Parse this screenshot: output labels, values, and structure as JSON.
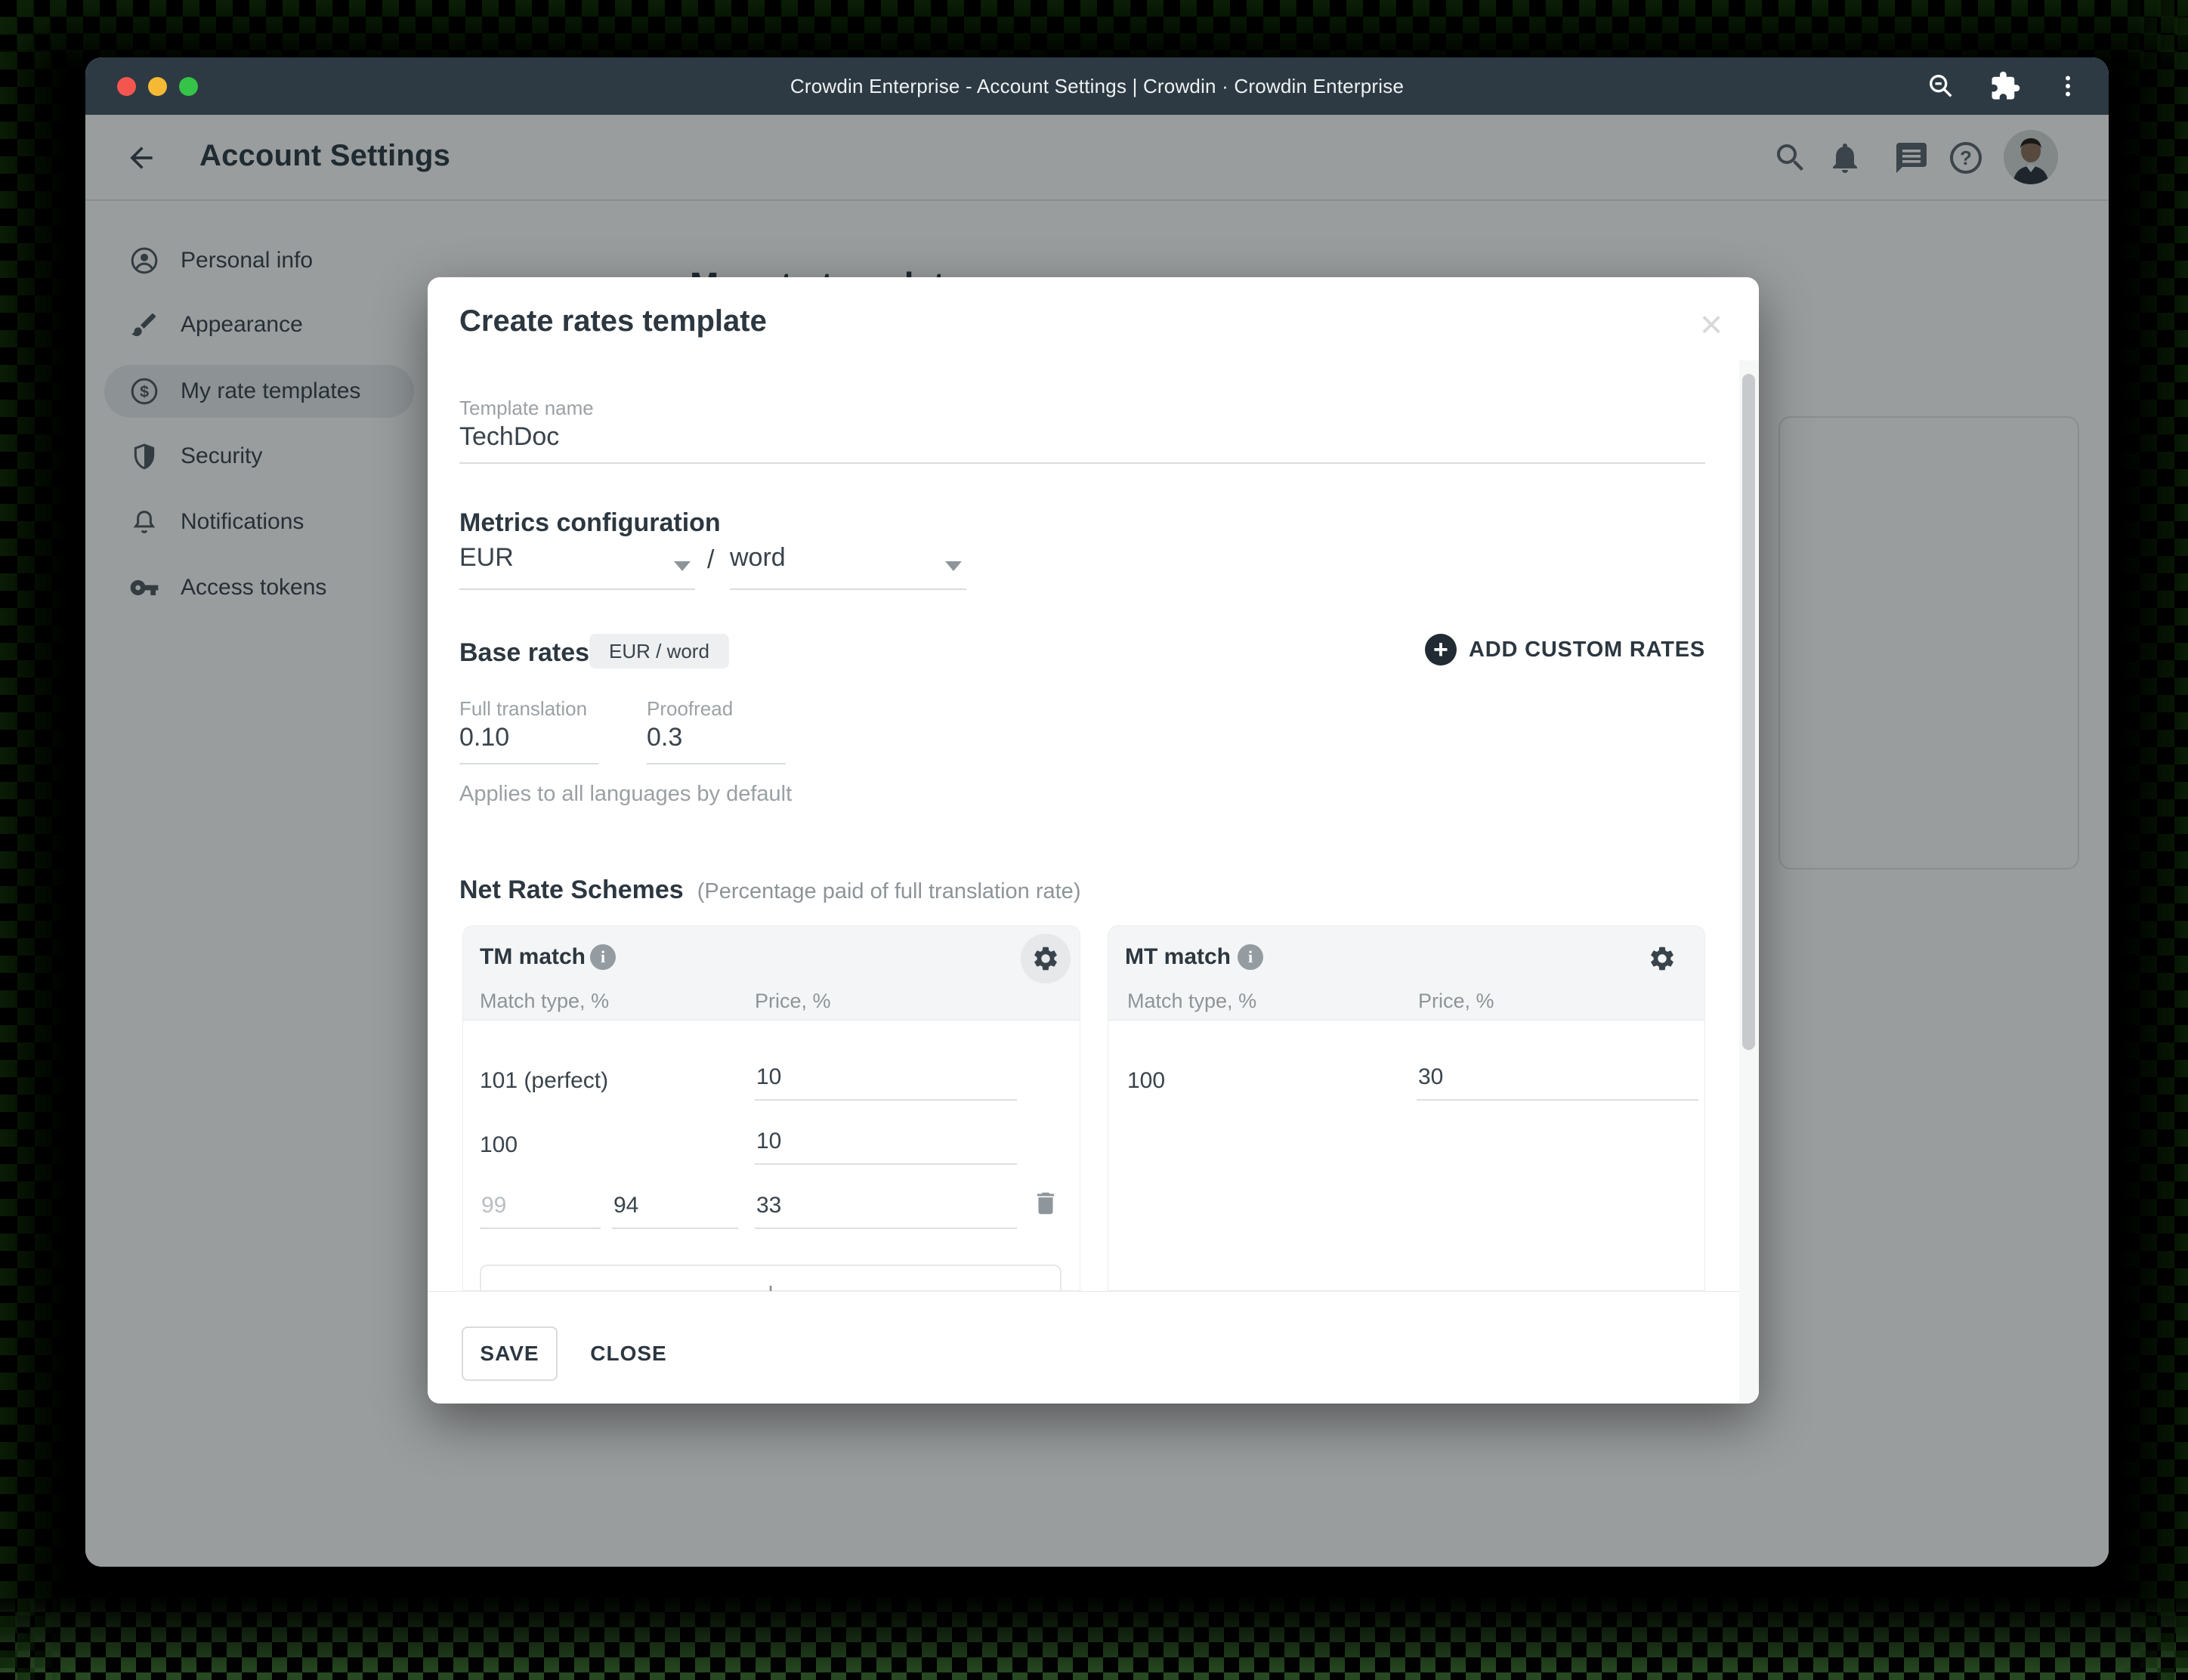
{
  "titlebar": {
    "title": "Crowdin Enterprise - Account Settings | Crowdin · Crowdin Enterprise"
  },
  "header": {
    "title": "Account Settings"
  },
  "sidebar": {
    "items": [
      {
        "label": "Personal info"
      },
      {
        "label": "Appearance"
      },
      {
        "label": "My rate templates"
      },
      {
        "label": "Security"
      },
      {
        "label": "Notifications"
      },
      {
        "label": "Access tokens"
      }
    ]
  },
  "page": {
    "heading": "My rate templates"
  },
  "modal": {
    "title": "Create rates template",
    "close_glyph": "×",
    "template_name": {
      "label": "Template name",
      "value": "TechDoc"
    },
    "metrics": {
      "heading": "Metrics configuration",
      "currency": "EUR",
      "separator": "/",
      "unit": "word"
    },
    "base_rates": {
      "heading": "Base rates",
      "badge": "EUR / word",
      "add_button": "ADD CUSTOM RATES",
      "plus_glyph": "+",
      "fields": [
        {
          "label": "Full translation",
          "value": "0.10"
        },
        {
          "label": "Proofread",
          "value": "0.3"
        }
      ],
      "note": "Applies to all languages by default"
    },
    "net_rate_schemes": {
      "heading": "Net Rate Schemes",
      "subheading": "(Percentage paid of full translation rate)",
      "columns": {
        "match": "Match type, %",
        "price": "Price, %"
      },
      "cards": [
        {
          "title": "TM match",
          "info_glyph": "i",
          "rows": [
            {
              "match": "101 (perfect)",
              "price": "10"
            },
            {
              "match": "100",
              "price": "10"
            },
            {
              "match_placeholder": "99",
              "match_value": "94",
              "price": "33"
            }
          ],
          "add_row_glyph": "+"
        },
        {
          "title": "MT match",
          "info_glyph": "i",
          "rows": [
            {
              "match": "100",
              "price": "30"
            }
          ]
        }
      ]
    },
    "footer": {
      "save": "SAVE",
      "close": "CLOSE"
    }
  },
  "colors": {
    "titlebar": "#2d3a43",
    "accent_dark": "#222b33",
    "overlay": "rgba(14,21,25,0.42)",
    "selected_pill": "#e9ecef",
    "card_header": "#f4f5f6",
    "traffic_red": "#f4554f",
    "traffic_yellow": "#f5b935",
    "traffic_green": "#35c348"
  }
}
